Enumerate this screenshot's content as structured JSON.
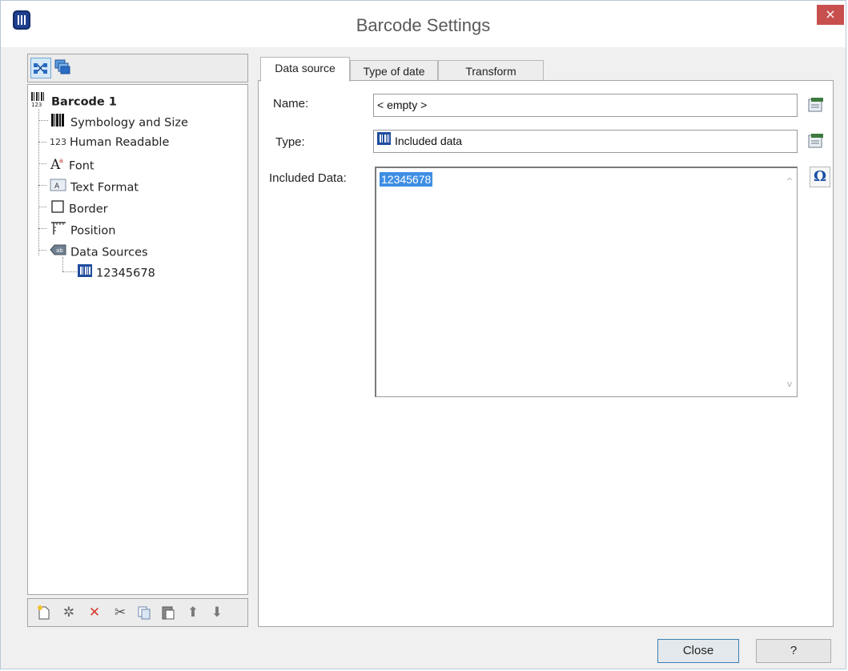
{
  "window": {
    "title": "Barcode Settings",
    "close_glyph": "×"
  },
  "left_toolbar": {
    "icons": [
      "tree-view-icon",
      "layers-icon"
    ]
  },
  "tree": {
    "root": {
      "label": "Barcode 1",
      "icon": "barcode-123-icon"
    },
    "items": [
      {
        "label": "Symbology and Size",
        "icon": "barcode-icon"
      },
      {
        "label": "Human Readable",
        "prefix": "123"
      },
      {
        "label": "Font",
        "icon": "font-icon"
      },
      {
        "label": "Text Format",
        "icon": "text-format-icon"
      },
      {
        "label": "Border",
        "icon": "border-icon"
      },
      {
        "label": "Position",
        "icon": "position-icon"
      },
      {
        "label": "Data Sources",
        "icon": "data-sources-icon"
      }
    ],
    "child": {
      "label": "12345678",
      "icon": "included-data-icon"
    }
  },
  "bottom_toolbar": {
    "icons": [
      "new-icon",
      "wand-icon",
      "delete-icon",
      "cut-icon",
      "copy-icon",
      "paste-icon",
      "move-up-icon",
      "move-down-icon"
    ],
    "glyphs": {
      "wand": "✲",
      "delete": "✕",
      "cut": "✂",
      "up": "⬆",
      "down": "⬇"
    },
    "colors": {
      "delete": "#d93a2b",
      "arrows": "#7a7a7a"
    }
  },
  "tabs": [
    {
      "label": "Data source",
      "selected": true
    },
    {
      "label": "Type of date",
      "selected": false
    },
    {
      "label": "Transform",
      "selected": false
    }
  ],
  "form": {
    "name_label": "Name:",
    "name_value": "< empty >",
    "type_label": "Type:",
    "type_value": "Included data",
    "included_label": "Included Data:",
    "included_value": "12345678",
    "omega_glyph": "Ω"
  },
  "scroll": {
    "up": "^",
    "down": "v"
  },
  "buttons": {
    "close": "Close",
    "help": "?"
  },
  "colors": {
    "accent": "#3e8ee3",
    "close_red": "#c7504e",
    "title_text": "#5a5a5a"
  }
}
